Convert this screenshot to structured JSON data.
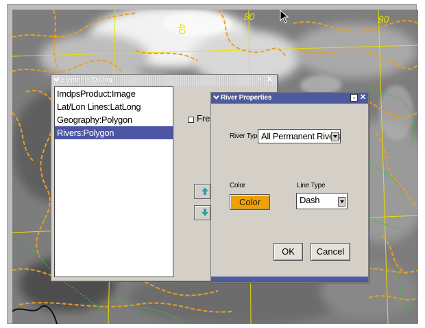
{
  "map": {
    "lon_labels": [
      "80",
      "90",
      "40"
    ],
    "colors": {
      "coastline": "#e9a020",
      "border": "#2fc42f",
      "grid": "#e8e000",
      "cloud": "#f4f4f4"
    }
  },
  "elements_dialog": {
    "title": "Elements Dialog",
    "items": [
      "ImdpsProduct:Image",
      "Lat/Lon Lines:LatLong",
      "Geography:Polygon",
      "Rivers:Polygon"
    ],
    "selected_index": 3,
    "freeze_label": "Free",
    "icons": [
      "chevron-down-icon",
      "minimize-icon",
      "close-icon",
      "arrow-up-icon",
      "arrow-down-icon"
    ]
  },
  "river_properties": {
    "title": "River Properties",
    "river_type_label": "River Type",
    "river_type_value": "All Permanent Rivers",
    "color_label": "Color",
    "color_button": "Color",
    "color_value": "#f0a000",
    "line_type_label": "Line Type",
    "line_type_value": "Dash",
    "ok": "OK",
    "cancel": "Cancel"
  }
}
